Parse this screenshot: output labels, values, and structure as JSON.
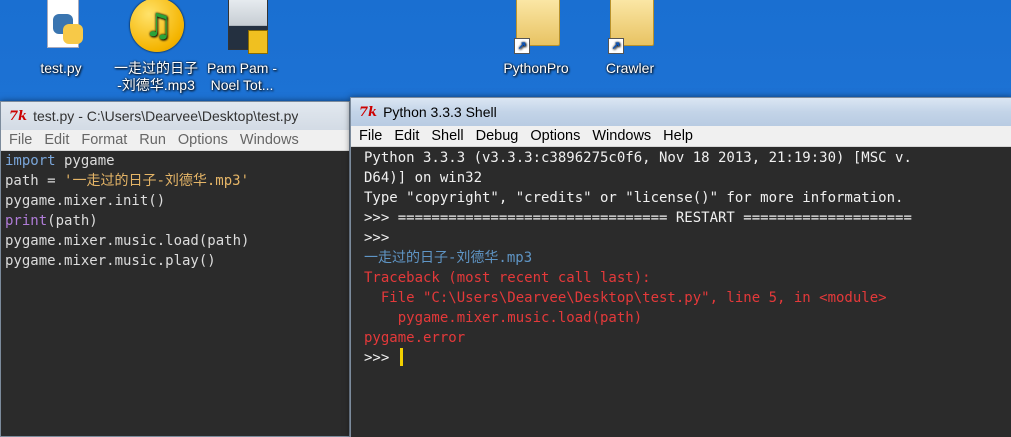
{
  "desktop": {
    "icons": [
      {
        "label": "test.py"
      },
      {
        "label": "一走过的日子\n-刘德华.mp3"
      },
      {
        "label": "Pam Pam -\nNoel Tot..."
      },
      {
        "label": "PythonPro"
      },
      {
        "label": "Crawler"
      }
    ]
  },
  "editor_window": {
    "title": "test.py - C:\\Users\\Dearvee\\Desktop\\test.py",
    "menu": [
      "File",
      "Edit",
      "Format",
      "Run",
      "Options",
      "Windows"
    ],
    "code": {
      "l1_kw": "import",
      "l1_rest": " pygame",
      "l2_pre": "path = ",
      "l2_str": "'一走过的日子-刘德华.mp3'",
      "l3": "pygame.mixer.init()",
      "l4_bi": "print",
      "l4_rest": "(path)",
      "l5": "pygame.mixer.music.load(path)",
      "l6": "pygame.mixer.music.play()"
    }
  },
  "shell_window": {
    "title": "Python 3.3.3 Shell",
    "menu": [
      "File",
      "Edit",
      "Shell",
      "Debug",
      "Options",
      "Windows",
      "Help"
    ],
    "lines": {
      "banner1": "Python 3.3.3 (v3.3.3:c3896275c0f6, Nov 18 2013, 21:19:30) [MSC v.",
      "banner2": "D64)] on win32",
      "banner3": "Type \"copyright\", \"credits\" or \"license()\" for more information.",
      "restart": ">>> ================================ RESTART ====================",
      "prompt1": ">>>",
      "output": "一走过的日子-刘德华.mp3",
      "tb1": "Traceback (most recent call last):",
      "tb2": "  File \"C:\\Users\\Dearvee\\Desktop\\test.py\", line 5, in <module>",
      "tb3": "    pygame.mixer.music.load(path)",
      "tb4": "pygame.error",
      "prompt2": ">>> "
    }
  }
}
